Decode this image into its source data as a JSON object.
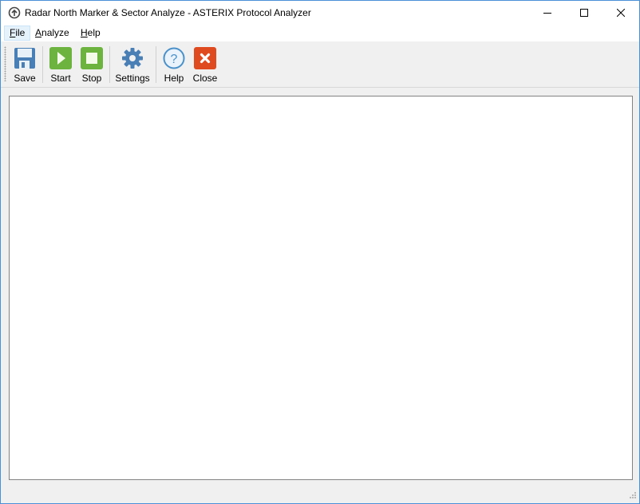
{
  "window": {
    "title": "Radar North Marker & Sector Analyze - ASTERIX Protocol Analyzer",
    "app_icon": "circle-up-arrow-icon",
    "controls": {
      "minimize": "minimize-icon",
      "maximize": "maximize-icon",
      "close": "close-icon"
    }
  },
  "menubar": {
    "items": [
      {
        "label": "File",
        "mnemonic": "F",
        "rest": "ile",
        "active": true
      },
      {
        "label": "Analyze",
        "mnemonic": "A",
        "rest": "nalyze",
        "active": false
      },
      {
        "label": "Help",
        "mnemonic": "H",
        "rest": "elp",
        "active": false
      }
    ]
  },
  "toolbar": {
    "buttons": [
      {
        "label": "Save",
        "icon": "floppy-disk-icon",
        "color": "#4a7fb5"
      },
      {
        "label": "Start",
        "icon": "play-icon",
        "color": "#6db33f"
      },
      {
        "label": "Stop",
        "icon": "stop-icon",
        "color": "#6db33f"
      },
      {
        "label": "Settings",
        "icon": "gear-icon",
        "color": "#4a7fb5"
      },
      {
        "label": "Help",
        "icon": "question-icon",
        "color": "#4a90c9"
      },
      {
        "label": "Close",
        "icon": "close-x-icon",
        "color": "#e04a1f"
      }
    ]
  },
  "content": {
    "text": ""
  }
}
